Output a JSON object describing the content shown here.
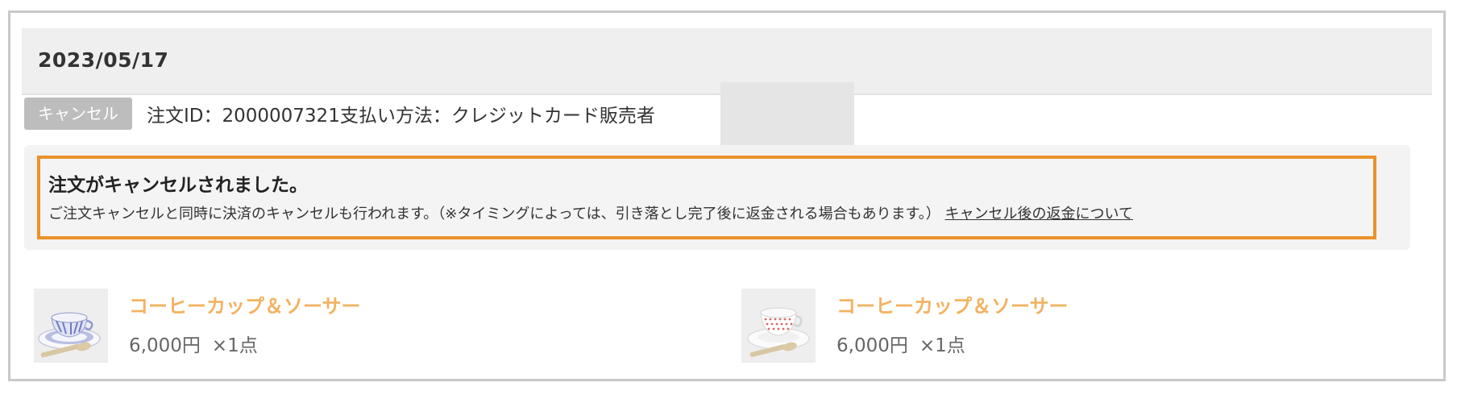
{
  "order": {
    "date": "2023/05/17",
    "status_badge": "キャンセル",
    "order_id_text": "注文ID：2000007321",
    "payment_text": "支払い方法：クレジットカード",
    "seller_label": "販売者"
  },
  "notice": {
    "title": "注文がキャンセルされました。",
    "body": "ご注文キャンセルと同時に決済のキャンセルも行われます。（※タイミングによっては、引き落とし完了後に返金される場合もあります。）",
    "link_label": "キャンセル後の返金について"
  },
  "products": [
    {
      "name": "コーヒーカップ＆ソーサー",
      "price": "6,000円",
      "quantity": "×1点",
      "thumbnail_icon": "blue-cup-and-saucer-image"
    },
    {
      "name": "コーヒーカップ＆ソーサー",
      "price": "6,000円",
      "quantity": "×1点",
      "thumbnail_icon": "red-dot-cup-and-saucer-image"
    }
  ],
  "colors": {
    "notice_border": "#ea9229",
    "product_name": "#f2b362",
    "badge_bg": "#bdbdbd"
  }
}
